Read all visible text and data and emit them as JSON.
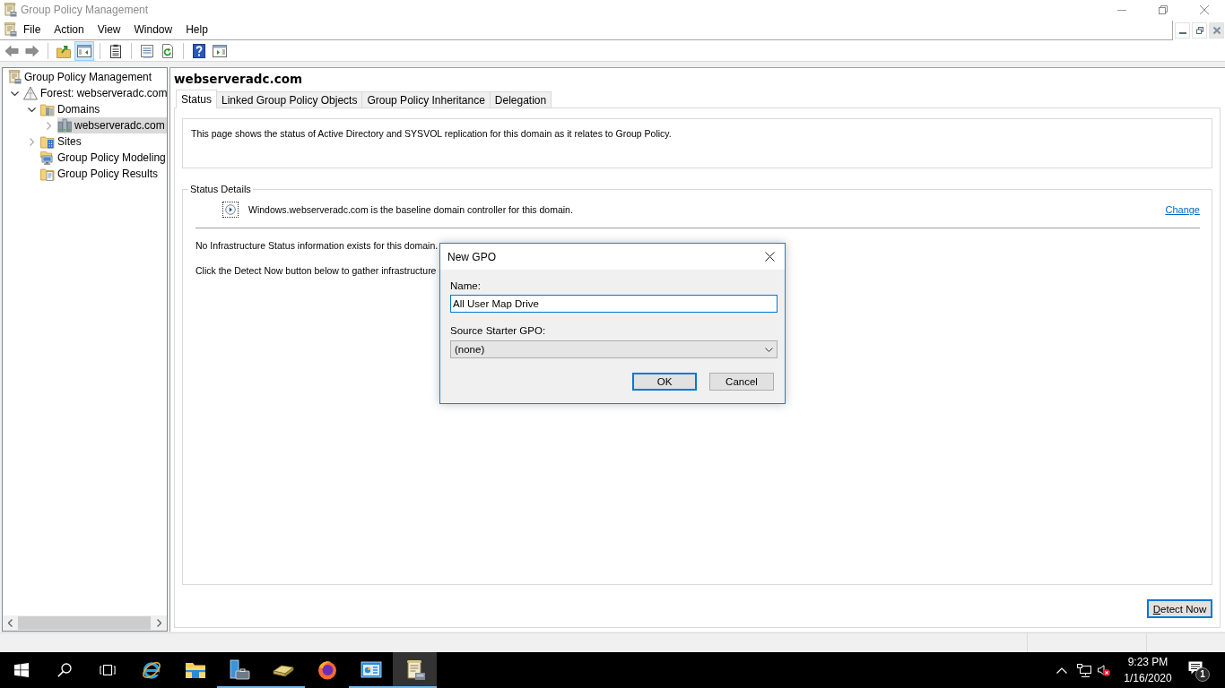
{
  "window": {
    "title": "Group Policy Management"
  },
  "menu": [
    "File",
    "Action",
    "View",
    "Window",
    "Help"
  ],
  "toolbar": [
    [
      {
        "kind": "back",
        "pressed": false
      },
      {
        "kind": "forward",
        "pressed": false
      }
    ],
    [
      {
        "kind": "up",
        "pressed": false
      },
      {
        "kind": "console-tree",
        "pressed": true
      }
    ],
    [
      {
        "kind": "export",
        "pressed": false
      }
    ],
    [
      {
        "kind": "properties",
        "pressed": false
      },
      {
        "kind": "refresh",
        "pressed": false
      }
    ],
    [
      {
        "kind": "help",
        "pressed": false
      },
      {
        "kind": "action-pane",
        "pressed": false
      }
    ]
  ],
  "tree": [
    {
      "label": "Group Policy Management",
      "kind": "console",
      "selected": false,
      "children": [
        {
          "label": "Forest: webserveradc.com",
          "kind": "forest",
          "expanded": true,
          "selected": false,
          "children": [
            {
              "label": "Domains",
              "kind": "domains",
              "expanded": true,
              "selected": false,
              "children": [
                {
                  "label": "webserveradc.com",
                  "kind": "domain",
                  "expanded": false,
                  "selected": true
                }
              ]
            },
            {
              "label": "Sites",
              "kind": "sites",
              "expanded": false,
              "selected": false
            },
            {
              "label": "Group Policy Modeling",
              "kind": "modeling",
              "selected": false
            },
            {
              "label": "Group Policy Results",
              "kind": "results",
              "selected": false
            }
          ]
        }
      ]
    }
  ],
  "details": {
    "heading": "webserveradc.com",
    "tabs": [
      {
        "label": "Status",
        "selected": true
      },
      {
        "label": "Linked Group Policy Objects",
        "selected": false
      },
      {
        "label": "Group Policy Inheritance",
        "selected": false
      },
      {
        "label": "Delegation",
        "selected": false
      }
    ],
    "info": "This page shows the status of Active Directory and SYSVOL replication for this domain as it relates to Group Policy.",
    "status_details": {
      "title": "Status Details",
      "baseline": "Windows.webserveradc.com is the baseline domain controller for this domain.",
      "change_link": "Change",
      "messages": [
        "No Infrastructure Status information exists for this domain.",
        "Click the Detect Now button below to gather infrastructure"
      ]
    },
    "detect_button": {
      "label": "Detect Now",
      "default": true
    }
  },
  "dialog": {
    "title": "New GPO",
    "name_label": "Name:",
    "name_value": "All User Map Drive",
    "name_focused": true,
    "source_label": "Source Starter GPO:",
    "source_value": "(none)",
    "buttons": [
      {
        "label": "OK",
        "default": true
      },
      {
        "label": "Cancel",
        "default": false
      }
    ]
  },
  "taskbar": {
    "apps": [
      {
        "kind": "ring",
        "running": false,
        "active": false
      },
      {
        "kind": "folder",
        "running": false,
        "active": false
      },
      {
        "kind": "tower",
        "running": true,
        "active": false
      },
      {
        "kind": "book",
        "running": true,
        "active": false
      },
      {
        "kind": "globe",
        "running": false,
        "active": false
      },
      {
        "kind": "chart-window",
        "running": true,
        "active": false
      },
      {
        "kind": "scroll",
        "running": true,
        "active": true
      }
    ],
    "tray": {
      "muted": true,
      "time": "9:23 PM",
      "date": "1/16/2020",
      "notification_count": "1"
    }
  }
}
